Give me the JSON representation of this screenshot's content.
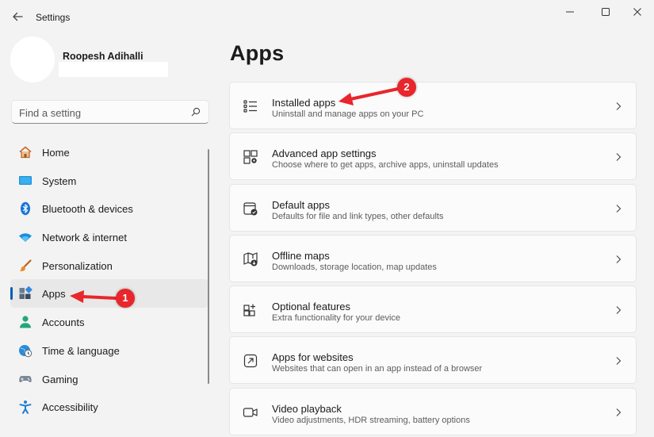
{
  "window": {
    "title": "Settings",
    "back_icon": "back-arrow-icon",
    "controls": [
      "minimize-icon",
      "maximize-icon",
      "close-icon"
    ]
  },
  "profile": {
    "name": "Roopesh Adihalli"
  },
  "search": {
    "placeholder": "Find a setting",
    "icon": "search-icon"
  },
  "sidebar": {
    "selected": "Apps",
    "items": [
      {
        "label": "Home",
        "icon": "home-icon"
      },
      {
        "label": "System",
        "icon": "system-icon"
      },
      {
        "label": "Bluetooth & devices",
        "icon": "bluetooth-icon"
      },
      {
        "label": "Network & internet",
        "icon": "wifi-icon"
      },
      {
        "label": "Personalization",
        "icon": "brush-icon"
      },
      {
        "label": "Apps",
        "icon": "apps-icon"
      },
      {
        "label": "Accounts",
        "icon": "person-icon"
      },
      {
        "label": "Time & language",
        "icon": "globe-clock-icon"
      },
      {
        "label": "Gaming",
        "icon": "gamepad-icon"
      },
      {
        "label": "Accessibility",
        "icon": "accessibility-icon"
      }
    ]
  },
  "main": {
    "title": "Apps",
    "cards": [
      {
        "title": "Installed apps",
        "subtitle": "Uninstall and manage apps on your PC",
        "icon": "list-icon"
      },
      {
        "title": "Advanced app settings",
        "subtitle": "Choose where to get apps, archive apps, uninstall updates",
        "icon": "app-settings-icon"
      },
      {
        "title": "Default apps",
        "subtitle": "Defaults for file and link types, other defaults",
        "icon": "default-apps-icon"
      },
      {
        "title": "Offline maps",
        "subtitle": "Downloads, storage location, map updates",
        "icon": "map-icon"
      },
      {
        "title": "Optional features",
        "subtitle": "Extra functionality for your device",
        "icon": "add-features-icon"
      },
      {
        "title": "Apps for websites",
        "subtitle": "Websites that can open in an app instead of a browser",
        "icon": "open-link-icon"
      },
      {
        "title": "Video playback",
        "subtitle": "Video adjustments, HDR streaming, battery options",
        "icon": "video-icon"
      }
    ]
  },
  "annotations": [
    {
      "number": "1",
      "target": "Apps"
    },
    {
      "number": "2",
      "target": "Installed apps"
    }
  ],
  "colors": {
    "accent": "#005fb8",
    "annotation": "#e8262b",
    "background": "#f3f3f3",
    "card": "#fbfbfb"
  }
}
